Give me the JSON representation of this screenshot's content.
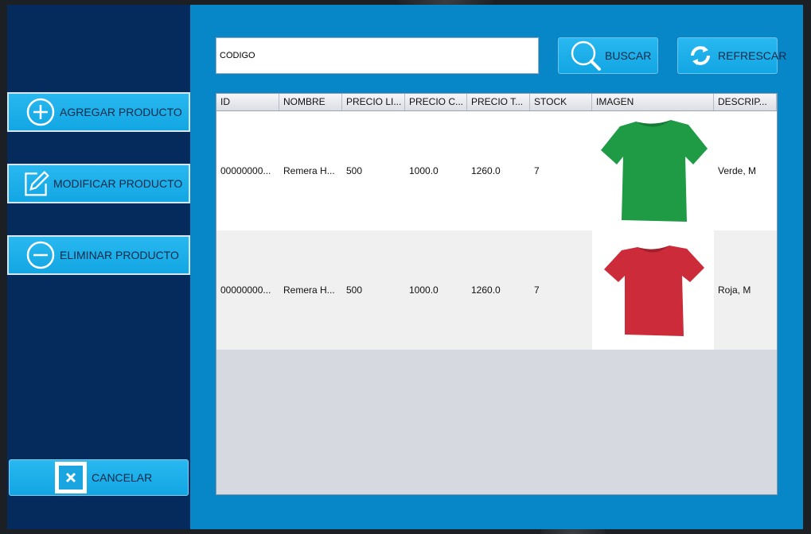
{
  "sidebar": {
    "add_label": "AGREGAR PRODUCTO",
    "edit_label": "MODIFICAR PRODUCTO",
    "delete_label": "ELIMINAR PRODUCTO",
    "cancel_label": "CANCELAR"
  },
  "search": {
    "value": "CÓDIGO",
    "search_label": "BUSCAR",
    "refresh_label": "REFRESCAR"
  },
  "table": {
    "columns": [
      "ID",
      "NOMBRE",
      "PRECIO LI...",
      "PRECIO C...",
      "PRECIO T...",
      "STOCK",
      "IMAGEN",
      "DESCRIP..."
    ],
    "rows": [
      {
        "id": "00000000...",
        "nombre": "Remera H...",
        "precio_lista": "500",
        "precio_costo": "1000.0",
        "precio_total": "1260.0",
        "stock": "7",
        "imagen": "green-tshirt",
        "descripcion": "Verde, M"
      },
      {
        "id": "00000000...",
        "nombre": "Remera H...",
        "precio_lista": "500",
        "precio_costo": "1000.0",
        "precio_total": "1260.0",
        "stock": "7",
        "imagen": "red-tshirt",
        "descripcion": "Roja, M"
      }
    ]
  },
  "colors": {
    "sidebar": "#052b5c",
    "main": "#0787c8",
    "button": "#1aa9e4",
    "shirt_green": "#1f9a45",
    "shirt_red": "#cc2b3a"
  }
}
